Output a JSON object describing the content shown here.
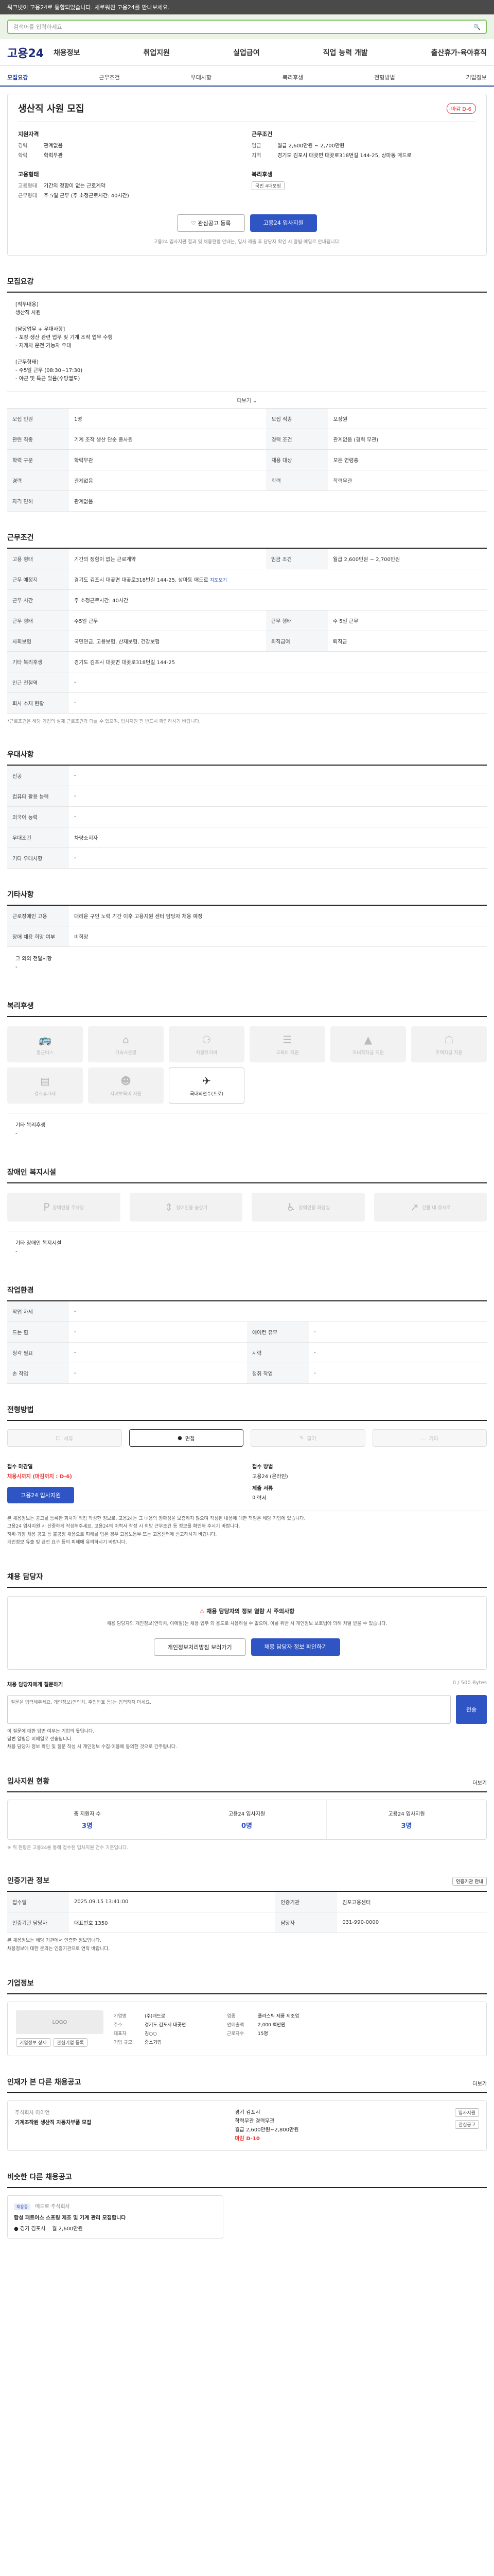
{
  "top_banner": "워크넷이 고용24로 통합되었습니다. 새로워진 고용24를 만나보세요.",
  "search": {
    "placeholder": "검색어를 입력하세요",
    "button": "검색"
  },
  "gnb": {
    "logo": "고용24",
    "menu": [
      "채용정보",
      "취업지원",
      "실업급여",
      "직업 능력 개발",
      "출산휴가·육아휴직"
    ]
  },
  "subnav": [
    "모집요강",
    "근무조건",
    "우대사항",
    "복리후생",
    "전형방법",
    "기업정보"
  ],
  "job": {
    "title": "생산직 사원 모집",
    "badge": "마감 D-6",
    "recruit_head": "지원자격",
    "cond_head": "근무조건",
    "rows_left": [
      {
        "k": "경력",
        "v": "관계없음"
      },
      {
        "k": "학력",
        "v": "학력무관"
      }
    ],
    "rows_right": [
      {
        "k": "임금",
        "v": "월급 2,600만원 ~ 2,700만원"
      },
      {
        "k": "지역",
        "v": "경기도 김포시 대곶면 대곶로318번길 144-25, 상마동 매드로"
      }
    ],
    "type_head": "고용형태",
    "benefit_head": "복리후생",
    "rows_left2": [
      {
        "k": "고용형태",
        "v": "기간의 정함이 없는 근로계약"
      },
      {
        "k": "근무형태",
        "v": "주 5일 근무 (주 소정근로시간: 40시간)"
      }
    ],
    "benefit_chip": "국민 4대보험",
    "btn_scrap": "관심공고 등록",
    "btn_apply": "고용24 입사지원",
    "note": "고용24 입사지원 결과 및 채용현황 안내는, 입사 제출 후 담당자 확인 시 알림·메일로 안내됩니다."
  },
  "recruit": {
    "title": "모집요강",
    "lines": [
      "[직무내용]",
      "생산직 사원",
      "",
      "[담당업무 + 우대사항]",
      "- 포장·생산 관련 업무 및 기계 조작 업무 수행",
      "- 지게차 운전 가능자 우대",
      "",
      "[근무형태]",
      "- 주5일 근무 (08:30~17:30)",
      "- 야근 및 특근 있음(수당별도)"
    ],
    "more": "더보기",
    "table": [
      [
        {
          "k": "모집 인원",
          "v": "1명"
        },
        {
          "k": "모집 직종",
          "v": "포장원"
        }
      ],
      [
        {
          "k": "관련 직종",
          "v": "기계 조작 생산 단순 종사원"
        },
        {
          "k": "경력 조건",
          "v": "관계없음 (경력 무관)"
        }
      ],
      [
        {
          "k": "학력 구분",
          "v": "학력무관"
        },
        {
          "k": "채용 대상",
          "v": "모든 연령층"
        }
      ],
      [
        {
          "k": "경력",
          "v": "관계없음"
        },
        {
          "k": "학력",
          "v": "학력무관"
        }
      ],
      [
        {
          "k": "자격 면허",
          "v": "관계없음"
        }
      ]
    ]
  },
  "work": {
    "title": "근무조건",
    "rows": [
      {
        "k": "고용 형태",
        "v": "기간의 정함이 없는 근로계약",
        "k2": "임금 조건",
        "v2": "월급 2,600만원 ~ 2,700만원"
      },
      {
        "k": "근무 예정지",
        "v": "경기도 김포시 대곶면 대곶로318번길 144-25, 상마동 매드로",
        "link": "지도보기"
      },
      {
        "k": "근무 시간",
        "v": "주 소정근로시간: 40시간"
      },
      {
        "k": "근무 형태",
        "v": "주5일 근무",
        "k2": "근무 형태",
        "v2": "주 5일 근무"
      },
      {
        "k": "사회보험",
        "v": "국민연금, 고용보험, 산재보험, 건강보험",
        "k2": "퇴직급여",
        "v2": "퇴직금"
      },
      {
        "k": "기타 복리후생",
        "v": "경기도 김포시 대곶면 대곶로318번길 144-25"
      },
      {
        "k": "인근 전철역",
        "v": "-"
      },
      {
        "k": "회사 소재 현황",
        "v": "-"
      }
    ],
    "note": "*근로조건은 해당 기업의 실제 근로조건과 다를 수 있으며, 입사지원 전 반드시 확인하시기 바랍니다."
  },
  "prefer": {
    "title": "우대사항",
    "rows": [
      {
        "k": "전공",
        "v": "-"
      },
      {
        "k": "컴퓨터 활용 능력",
        "v": "-"
      },
      {
        "k": "외국어 능력",
        "v": "-"
      },
      {
        "k": "우대조건",
        "v": "차량소지자"
      },
      {
        "k": "기타 우대사항",
        "v": "-"
      }
    ]
  },
  "other": {
    "title": "기타사항",
    "rows": [
      {
        "k": "근로장애인 고용",
        "v": "대리운 구인 노력 기간 이후 고용지원 센터 담당자 채용 예정"
      },
      {
        "k": "장애 채용 희망 여부",
        "v": "비희망"
      }
    ],
    "extra_label": "그 외의 전달사항",
    "extra_value": "-"
  },
  "welfare": {
    "title": "복리후생",
    "items": [
      "통근버스",
      "기숙사운영",
      "차량유지비",
      "교육비 지원",
      "자녀학자금 지원",
      "주택자금 지원",
      "경조휴가제",
      "자녀보육비 지원",
      "국내외연수(프로)"
    ],
    "active_index": 8,
    "other_label": "기타 복리후생",
    "other_value": "-"
  },
  "disabled": {
    "title": "장애인 복지시설",
    "items": [
      "장애인용 주차장",
      "장애인용 승강기",
      "장애인용 화장실",
      "건물 내 경사로"
    ],
    "other_label": "기타 장애인 복지시설",
    "other_value": "-"
  },
  "env": {
    "title": "작업환경",
    "rows": [
      {
        "k": "작업 자세",
        "v": "-",
        "k2": "",
        "v2": ""
      },
      {
        "k": "드는 힘",
        "v": "-",
        "k2": "에어컨 유무",
        "v2": "-"
      },
      {
        "k": "청각 필요",
        "v": "-",
        "k2": "시력",
        "v2": "-"
      },
      {
        "k": "손 작업",
        "v": "-",
        "k2": "청취 작업",
        "v2": "-"
      }
    ]
  },
  "method": {
    "title": "전형방법",
    "items": [
      "서류",
      "면접",
      "필기",
      "기타"
    ],
    "active_index": 1,
    "deadline_label": "접수 마감일",
    "deadline_value": "채용시까지 (마감까지 : D-6)",
    "receipt_label": "접수 방법",
    "receipt_value": "고용24 (온라인)",
    "docs_label": "제출 서류",
    "docs_value": "이력서",
    "btn": "고용24 입사지원",
    "notices": [
      "본 채용정보는 공고를 등록한 회사가 직접 작성한 정보로, 고용24는 그 내용의 정확성을 보증하지 않으며 작성된 내용에 대한 책임은 해당 기업에 있습니다.",
      "고용24 입사지원 시 신중하게 작성해주세요. 고용24의 이력서 작성 시 희망 근무조건 등 정보를 확인해 주시기 바랍니다.",
      "허위·과장 채용 공고 등 불공정 채용으로 피해를 입은 경우 고용노동부 또는 고용센터에 신고하시기 바랍니다.",
      "개인정보 유출 및 금전 요구 등의 피해에 유의하시기 바랍니다."
    ]
  },
  "contact": {
    "title": "채용 담당자",
    "alert": "채용 담당자의 정보 열람 시 주의사항",
    "desc": "채용 담당자의 개인정보(연락처, 이메일)는 채용 업무 외 용도로 사용하실 수 없으며, 이를 위반 시 개인정보 보호법에 의해 처벌 받을 수 있습니다.",
    "btn1": "개인정보처리방침 보러가기",
    "btn2": "채용 담당자 정보 확인하기",
    "inquiry_title": "채용 담당자에게 질문하기",
    "inquiry_count": "0 / 500 Bytes",
    "inquiry_placeholder": "질문을 입력해주세요. 개인정보(연락처, 주민번호 등)는 입력하지 마세요.",
    "inquiry_btn": "전송",
    "notes": [
      "이 질문에 대한 답변 여부는 기업의 몫입니다.",
      "답변 알림은 이메일로 전송됩니다.",
      "채용 담당자 정보 확인 및 질문 작성 시 개인정보 수집·이용에 동의한 것으로 간주됩니다."
    ]
  },
  "status": {
    "title": "입사지원 현황",
    "more": "더보기",
    "items": [
      {
        "label": "총 지원자 수",
        "num": "3명"
      },
      {
        "label": "고용24 입사지원",
        "num": "0명"
      },
      {
        "label": "고용24 입사지원",
        "num": "3명"
      }
    ],
    "note": "※ 위 현황은 고용24를 통해 접수된 입사지원 건수 기준입니다."
  },
  "agency": {
    "title": "인증기관 정보",
    "btn": "인증기관 안내",
    "rows": [
      {
        "k": "접수일",
        "v": "2025.09.15 13:41:00",
        "k2": "인증기관",
        "v2": "김포고용센터"
      },
      {
        "k": "인증기관 담당자",
        "v": "대표번호 1350",
        "k2": "담당자",
        "v2": "031-990-0000"
      }
    ],
    "notes": [
      "본 채용정보는 해당 기관에서 인증한 정보입니다.",
      "채용정보에 대한 문의는 인증기관으로 연락 바랍니다."
    ]
  },
  "company": {
    "title": "기업정보",
    "logo": "LOGO",
    "btn_detail": "기업정보 상세",
    "btn_interest": "관심기업 등록",
    "rows": [
      {
        "k": "기업명",
        "v": "(주)매드로",
        "k2": "업종",
        "v2": "플라스틱 제품 제조업"
      },
      {
        "k": "주소",
        "v": "경기도 김포시 대곶면",
        "k2": "연매출액",
        "v2": "2,000 백만원"
      },
      {
        "k": "대표자",
        "v": "김○○",
        "k2": "근로자수",
        "v2": "15명"
      },
      {
        "k": "기업 규모",
        "v": "중소기업",
        "k2": "",
        "v2": ""
      }
    ]
  },
  "related": {
    "title": "인재가 본 다른 채용공고",
    "more": "더보기",
    "left_company": "주식회사 아이언",
    "left_title": "기계조작원 생산직 자동차부품 모집",
    "right_lines": [
      "경기 김포시",
      "학력무관 경력무관",
      "월급 2,600만원~2,800만원",
      "마감 D-10"
    ],
    "btns": [
      "입사지원",
      "관심공고"
    ]
  },
  "similar": {
    "title": "비슷한 다른 채용공고",
    "tag": "채용중",
    "company": "매드로 주식회사",
    "job": "합성 패트어스 스프링 제조 및 기계 관리 모집합니다",
    "loc": "경기 김포시",
    "wage": "월 2,600만원"
  }
}
